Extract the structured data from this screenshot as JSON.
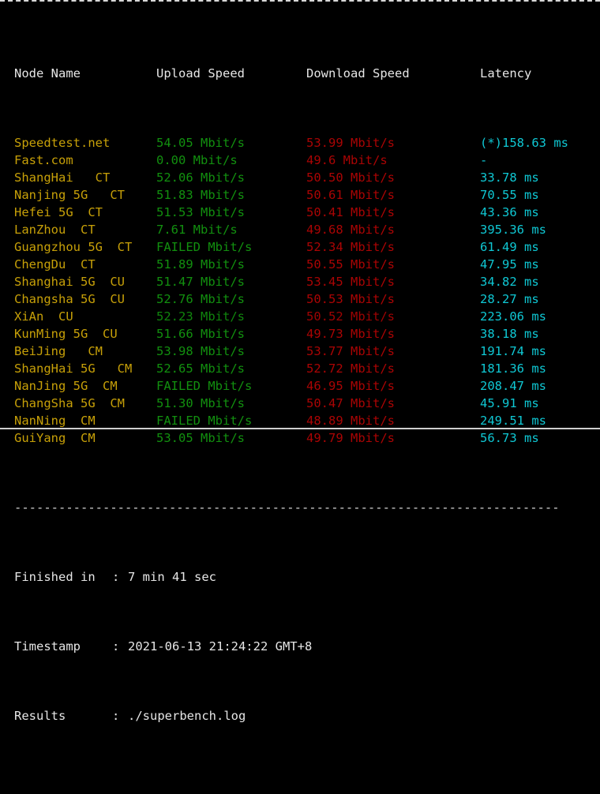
{
  "terminal": {
    "top_divider": "--------------------------------------------------------------------------",
    "mid_divider": "--------------------------------------------------------------------------"
  },
  "table": {
    "headers": {
      "node": "Node Name",
      "upload": "Upload Speed",
      "download": "Download Speed",
      "latency": "Latency"
    },
    "rows": [
      {
        "node": "Speedtest.net",
        "upload": "54.05 Mbit/s",
        "download": "53.99 Mbit/s",
        "latency": "(*)158.63 ms"
      },
      {
        "node": "Fast.com",
        "upload": "0.00 Mbit/s",
        "download": "49.6 Mbit/s",
        "latency": "-"
      },
      {
        "node": "ShangHai   CT",
        "upload": "52.06 Mbit/s",
        "download": "50.50 Mbit/s",
        "latency": "33.78 ms"
      },
      {
        "node": "Nanjing 5G   CT",
        "upload": "51.83 Mbit/s",
        "download": "50.61 Mbit/s",
        "latency": "70.55 ms"
      },
      {
        "node": "Hefei 5G  CT",
        "upload": "51.53 Mbit/s",
        "download": "50.41 Mbit/s",
        "latency": "43.36 ms"
      },
      {
        "node": "LanZhou  CT",
        "upload": "7.61 Mbit/s",
        "download": "49.68 Mbit/s",
        "latency": "395.36 ms"
      },
      {
        "node": "Guangzhou 5G  CT",
        "upload": "FAILED Mbit/s",
        "download": "52.34 Mbit/s",
        "latency": "61.49 ms"
      },
      {
        "node": "ChengDu  CT",
        "upload": "51.89 Mbit/s",
        "download": "50.55 Mbit/s",
        "latency": "47.95 ms"
      },
      {
        "node": "Shanghai 5G  CU",
        "upload": "51.47 Mbit/s",
        "download": "53.45 Mbit/s",
        "latency": "34.82 ms"
      },
      {
        "node": "Changsha 5G  CU",
        "upload": "52.76 Mbit/s",
        "download": "50.53 Mbit/s",
        "latency": "28.27 ms"
      },
      {
        "node": "XiAn  CU",
        "upload": "52.23 Mbit/s",
        "download": "50.52 Mbit/s",
        "latency": "223.06 ms"
      },
      {
        "node": "KunMing 5G  CU",
        "upload": "51.66 Mbit/s",
        "download": "49.73 Mbit/s",
        "latency": "38.18 ms"
      },
      {
        "node": "BeiJing   CM",
        "upload": "53.98 Mbit/s",
        "download": "53.77 Mbit/s",
        "latency": "191.74 ms"
      },
      {
        "node": "ShangHai 5G   CM",
        "upload": "52.65 Mbit/s",
        "download": "52.72 Mbit/s",
        "latency": "181.36 ms"
      },
      {
        "node": "NanJing 5G  CM",
        "upload": "FAILED Mbit/s",
        "download": "46.95 Mbit/s",
        "latency": "208.47 ms"
      },
      {
        "node": "ChangSha 5G  CM",
        "upload": "51.30 Mbit/s",
        "download": "50.47 Mbit/s",
        "latency": "45.91 ms"
      },
      {
        "node": "NanNing  CM",
        "upload": "FAILED Mbit/s",
        "download": "48.89 Mbit/s",
        "latency": "249.51 ms"
      },
      {
        "node": "GuiYang  CM",
        "upload": "53.05 Mbit/s",
        "download": "49.79 Mbit/s",
        "latency": "56.73 ms"
      }
    ]
  },
  "summary": {
    "finished_label": "Finished in",
    "finished_value": "7 min 41 sec",
    "timestamp_label": "Timestamp",
    "timestamp_value": "2021-06-13 21:24:22 GMT+8",
    "results_label": "Results",
    "results_value": "./superbench.log",
    "colon": ":"
  },
  "colors": {
    "background": "#000000",
    "header": "#e6e6e6",
    "node": "#c7a008",
    "upload": "#12900f",
    "download": "#aa0404",
    "latency": "#0fc8d4",
    "divider": "#d8d8d8"
  }
}
